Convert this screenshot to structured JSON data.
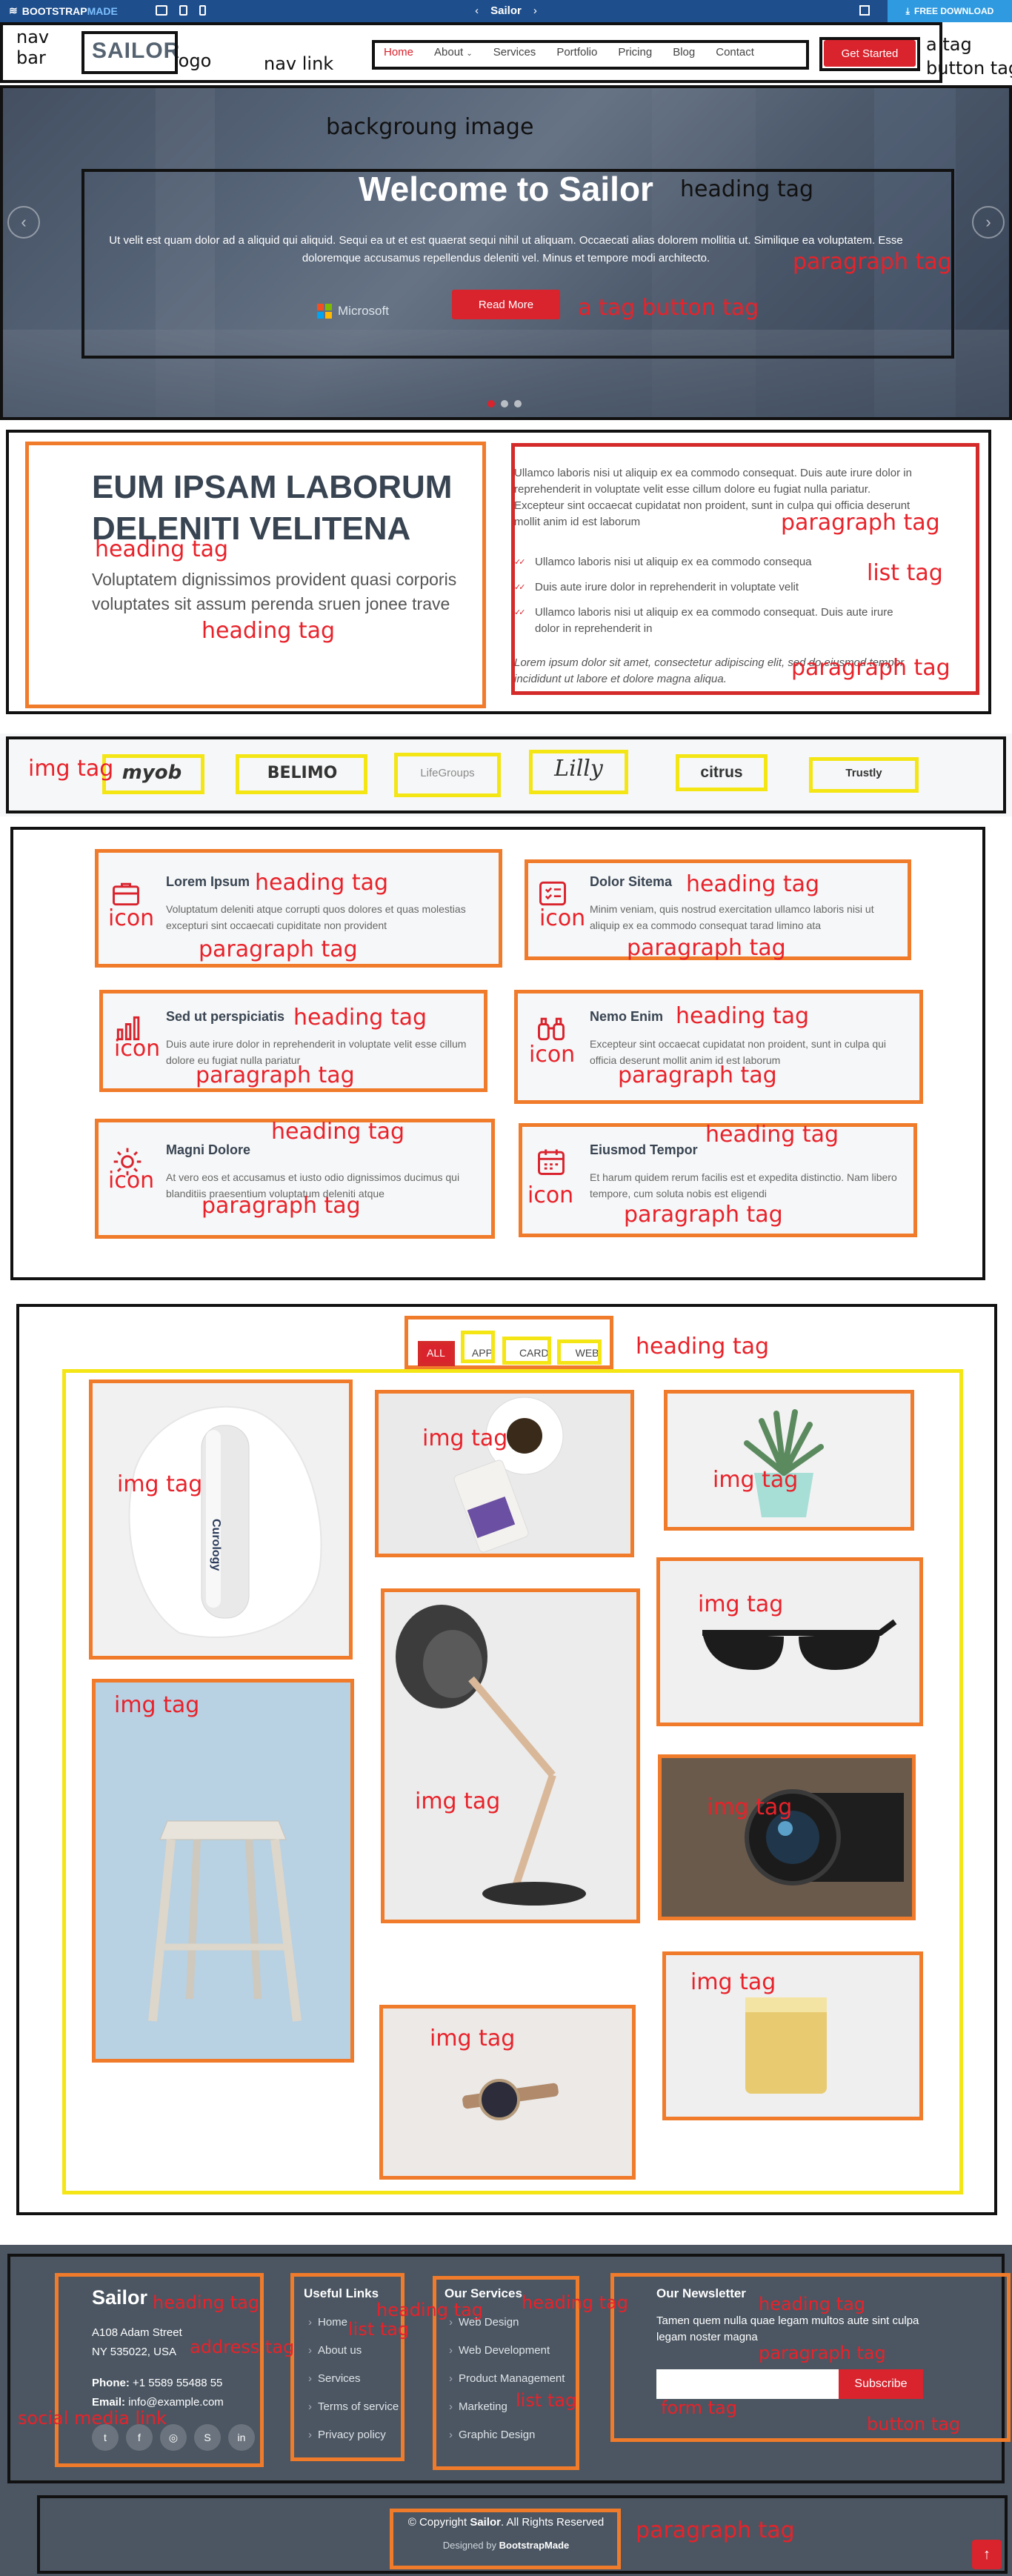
{
  "demo_bar": {
    "brand_bold": "BOOTSTRAP",
    "brand_light": "MADE",
    "title": "Sailor",
    "download_label": "FREE DOWNLOAD"
  },
  "header": {
    "logo": "SAILOR",
    "nav": [
      "Home",
      "About",
      "Services",
      "Portfolio",
      "Pricing",
      "Blog",
      "Contact"
    ],
    "cta": "Get Started"
  },
  "hero": {
    "title": "Welcome to Sailor",
    "text": "Ut velit est quam dolor ad a aliquid qui aliquid. Sequi ea ut et est quaerat sequi nihil ut aliquam. Occaecati alias dolorem mollitia ut. Similique ea voluptatem. Esse doloremque accusamus repellendus deleniti vel. Minus et tempore modi architecto.",
    "button": "Read More",
    "brand_in_photo": "Microsoft"
  },
  "about": {
    "title": "EUM IPSAM LABORUM DELENITI VELITENA",
    "subtitle": "Voluptatem dignissimos provident quasi corporis voluptates sit assum perenda sruen jonee trave",
    "paragraph": "Ullamco laboris nisi ut aliquip ex ea commodo consequat. Duis aute irure dolor in reprehenderit in voluptate velit esse cillum dolore eu fugiat nulla pariatur. Excepteur sint occaecat cupidatat non proident, sunt in culpa qui officia deserunt mollit anim id est laborum",
    "list": [
      "Ullamco laboris nisi ut aliquip ex ea commodo consequa",
      "Duis aute irure dolor in reprehenderit in voluptate velit",
      "Ullamco laboris nisi ut aliquip ex ea commodo consequat. Duis aute irure dolor in reprehenderit in"
    ],
    "italic": "Lorem ipsum dolor sit amet, consectetur adipiscing elit, sed do eiusmod tempor incididunt ut labore et dolore magna aliqua."
  },
  "clients": [
    "myob",
    "BELIMO",
    "LifeGroups",
    "Lilly",
    "citrus",
    "Trustly"
  ],
  "services": [
    {
      "icon": "briefcase-icon",
      "title": "Lorem Ipsum",
      "text": "Voluptatum deleniti atque corrupti quos dolores et quas molestias excepturi sint occaecati cupiditate non provident"
    },
    {
      "icon": "card-checklist-icon",
      "title": "Dolor Sitema",
      "text": "Minim veniam, quis nostrud exercitation ullamco laboris nisi ut aliquip ex ea commodo consequat tarad limino ata"
    },
    {
      "icon": "bar-chart-icon",
      "title": "Sed ut perspiciatis",
      "text": "Duis aute irure dolor in reprehenderit in voluptate velit esse cillum dolore eu fugiat nulla pariatur"
    },
    {
      "icon": "binoculars-icon",
      "title": "Nemo Enim",
      "text": "Excepteur sint occaecat cupidatat non proident, sunt in culpa qui officia deserunt mollit anim id est laborum"
    },
    {
      "icon": "brightness-icon",
      "title": "Magni Dolore",
      "text": "At vero eos et accusamus et iusto odio dignissimos ducimus qui blanditiis praesentium voluptatum deleniti atque"
    },
    {
      "icon": "calendar-icon",
      "title": "Eiusmod Tempor",
      "text": "Et harum quidem rerum facilis est et expedita distinctio. Nam libero tempore, cum soluta nobis est eligendi"
    }
  ],
  "portfolio": {
    "filters": [
      "ALL",
      "APP",
      "CARD",
      "WEB"
    ],
    "bottle_label": "Curology"
  },
  "footer": {
    "brand": "Sailor",
    "address_line1": "A108 Adam Street",
    "address_line2": "NY 535022, USA",
    "phone_label": "Phone:",
    "phone": "+1 5589 55488 55",
    "email_label": "Email:",
    "email": "info@example.com",
    "social": [
      "twitter",
      "facebook",
      "instagram",
      "skype",
      "linkedin"
    ],
    "useful_links_title": "Useful Links",
    "useful_links": [
      "Home",
      "About us",
      "Services",
      "Terms of service",
      "Privacy policy"
    ],
    "services_title": "Our Services",
    "services_links": [
      "Web Design",
      "Web Development",
      "Product Management",
      "Marketing",
      "Graphic Design"
    ],
    "newsletter_title": "Our Newsletter",
    "newsletter_text": "Tamen quem nulla quae legam multos aute sint culpa legam noster magna",
    "subscribe": "Subscribe",
    "copyright_prefix": "© Copyright",
    "copyright_brand": "Sailor",
    "copyright_suffix": ". All Rights Reserved",
    "designed_prefix": "Designed by",
    "designed_brand": "BootstrapMade"
  },
  "annotations": {
    "nav_bar": "nav\nbar",
    "logo": "logo",
    "nav_link": "nav link",
    "a_tag_button": "a tag\nbutton tag",
    "background_image": "backgroung image",
    "heading_tag": "heading tag",
    "paragraph_tag": "paragraph tag",
    "a_tag_button_tag": "a tag button tag",
    "list_tag": "list tag",
    "img_tag": "img tag",
    "icon": "icon",
    "address_tag": "address tag",
    "social_media_link": "social media link",
    "form_tag": "form tag",
    "button_tag": "button tag"
  }
}
